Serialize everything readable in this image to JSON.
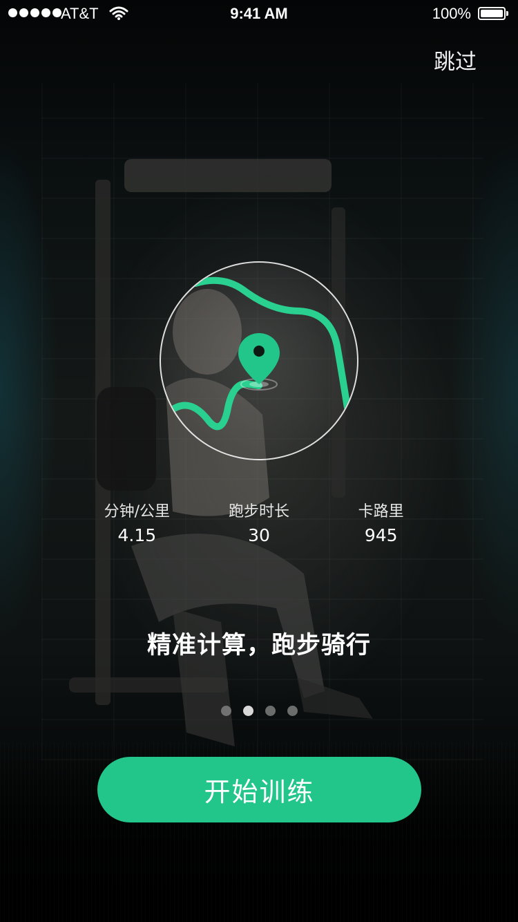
{
  "status_bar": {
    "carrier": "AT&T",
    "time": "9:41 AM",
    "battery_percent": "100%"
  },
  "skip_label": "跳过",
  "stats": [
    {
      "label": "分钟/公里",
      "value": "4.15"
    },
    {
      "label": "跑步时长",
      "value": "30"
    },
    {
      "label": "卡路里",
      "value": "945"
    }
  ],
  "headline": "精准计算，跑步骑行",
  "pager": {
    "pages": 4,
    "active_page": 2
  },
  "start_button_label": "开始训练",
  "colors": {
    "accent": "#22c58a",
    "route": "#2ad08f"
  },
  "icons": {
    "map_pin": "location-pin-icon",
    "wifi": "wifi-icon",
    "battery": "battery-icon"
  }
}
